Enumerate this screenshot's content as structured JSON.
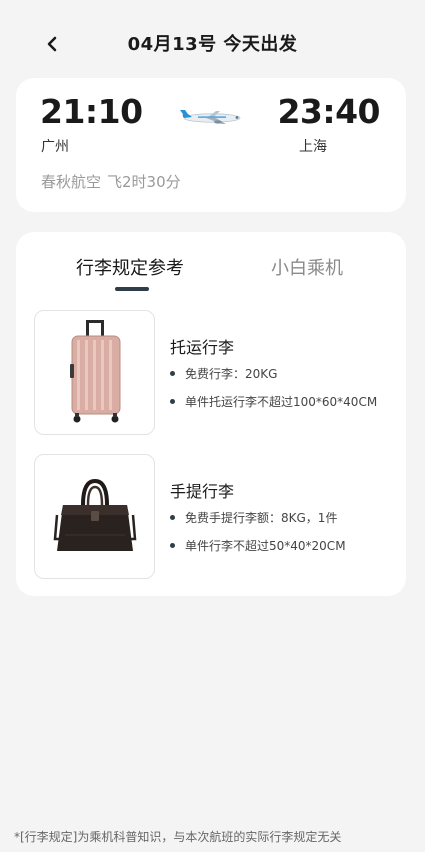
{
  "header": {
    "title": "04月13号 今天出发",
    "back_icon": "chevron-left-icon"
  },
  "flight": {
    "departure_time": "21:10",
    "departure_city": "广州",
    "arrival_time": "23:40",
    "arrival_city": "上海",
    "airline": "春秋航空",
    "duration": "飞2时30分",
    "plane_icon": "airplane-icon"
  },
  "tabs": [
    {
      "label": "行李规定参考",
      "active": true
    },
    {
      "label": "小白乘机",
      "active": false
    }
  ],
  "baggage": [
    {
      "title": "托运行李",
      "image": "suitcase-icon",
      "bullets": [
        "免费行李：20KG",
        "单件托运行李不超过100*60*40CM"
      ]
    },
    {
      "title": "手提行李",
      "image": "handbag-icon",
      "bullets": [
        "免费手提行李额：8KG，1件",
        "单件行李不超过50*40*20CM"
      ]
    }
  ],
  "footer": {
    "note": "*[行李规定]为乘机科普知识，与本次航班的实际行李规定无关"
  },
  "colors": {
    "background": "#f4f4f4",
    "card": "#ffffff",
    "accent_indicator": "#2f3e46",
    "muted_text": "#9a9a9a"
  }
}
